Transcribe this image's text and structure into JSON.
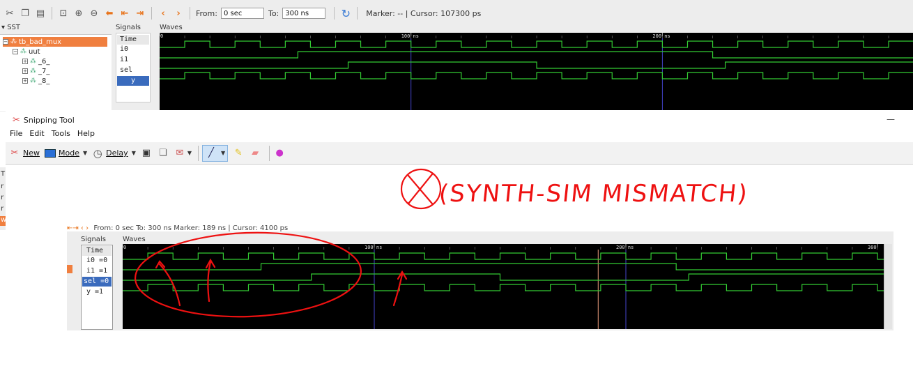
{
  "gtkwave": {
    "toolbar": {
      "from_label": "From:",
      "from_value": "0 sec",
      "to_label": "To:",
      "to_value": "300 ns",
      "status": "Marker: -- | Cursor: 107300 ps"
    },
    "sst": {
      "header": "SST",
      "tree": [
        {
          "label": "tb_bad_mux",
          "selected": true
        },
        {
          "label": "uut",
          "selected": false
        },
        {
          "label": "_6_",
          "selected": false
        },
        {
          "label": "_7_",
          "selected": false
        },
        {
          "label": "_8_",
          "selected": false
        }
      ]
    },
    "signals": {
      "header": "Signals",
      "rows": [
        "Time",
        "i0",
        "i1",
        "sel",
        "y"
      ]
    },
    "waves": {
      "header": "Waves",
      "time_labels": [
        "0",
        "100 ns",
        "200 ns"
      ],
      "signals": {
        "i0": {
          "period_ns": 20,
          "start": 0
        },
        "i1": {
          "transitions_ns": [
            55,
            220
          ],
          "start": 0
        },
        "sel": {
          "transitions_ns": [
            75,
            150,
            225
          ],
          "start": 0
        },
        "y": {
          "period_ns": 20,
          "start": 0
        }
      }
    }
  },
  "snipping_tool": {
    "title": "Snipping Tool",
    "menu": [
      "File",
      "Edit",
      "Tools",
      "Help"
    ],
    "toolbar": {
      "new": "New",
      "mode": "Mode",
      "delay": "Delay"
    },
    "inner_capture": {
      "toolbar_fragment": "From: 0 sec    To: 300 ns         Marker: 189 ns  |  Cursor: 4100 ps",
      "signals_header": "Signals",
      "waves_header": "Waves",
      "rows": [
        "Time",
        "i0 =0",
        "i1 =1",
        "sel =0",
        "y =1"
      ],
      "time_labels": [
        "0",
        "100 ns",
        "200 ns",
        "300"
      ]
    },
    "annotation": "(SYNTH-SIM   MISMATCH)"
  },
  "colors": {
    "wave": "#33cc33",
    "marker_line": "#4444cc",
    "annotation": "#ee1111",
    "selection_orange": "#f07f3f",
    "selection_blue": "#3a6bbd"
  },
  "icons": [
    "cut-icon",
    "copy-icon",
    "paste-icon",
    "zoom-fit-icon",
    "zoom-in-icon",
    "zoom-out-icon",
    "undo-icon",
    "first-icon",
    "last-icon",
    "left-icon",
    "right-icon",
    "reload-icon",
    "snip-scissors-icon",
    "monitor-icon",
    "clock-icon",
    "save-icon",
    "copy-doc-icon",
    "email-icon",
    "pen-icon",
    "highlighter-icon",
    "eraser-icon",
    "paint3d-icon"
  ]
}
